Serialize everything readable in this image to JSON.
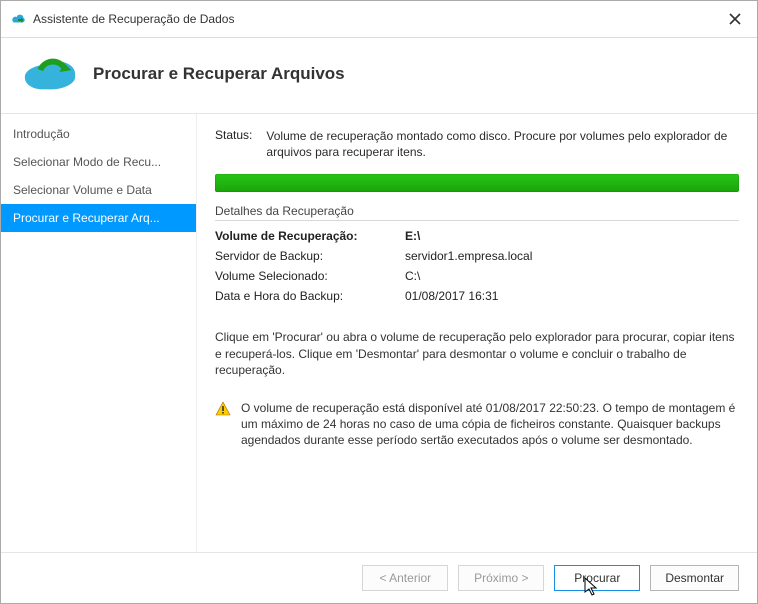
{
  "window": {
    "title": "Assistente de Recuperação de Dados"
  },
  "header": {
    "page_title": "Procurar e Recuperar Arquivos"
  },
  "sidebar": {
    "items": [
      {
        "label": "Introdução"
      },
      {
        "label": "Selecionar Modo de Recu..."
      },
      {
        "label": "Selecionar Volume e Data"
      },
      {
        "label": "Procurar e Recuperar Arq..."
      }
    ],
    "active_index": 3
  },
  "status": {
    "label": "Status:",
    "text": "Volume de recuperação montado como disco. Procure por volumes pelo explorador de arquivos para recuperar itens."
  },
  "recovery": {
    "section_title": "Detalhes da Recuperação",
    "rows": [
      {
        "label": "Volume de Recuperação:",
        "value": "E:\\",
        "bold": true
      },
      {
        "label": "Servidor de Backup:",
        "value": "servidor1.empresa.local"
      },
      {
        "label": "Volume Selecionado:",
        "value": "C:\\"
      },
      {
        "label": "Data e Hora do Backup:",
        "value": "01/08/2017 16:31"
      }
    ]
  },
  "instructions": "Clique em 'Procurar' ou abra o volume de recuperação pelo explorador para procurar, copiar itens e recuperá-los. Clique em 'Desmontar' para desmontar o volume e concluir o trabalho de recuperação.",
  "warning": "O volume de recuperação está disponível até 01/08/2017 22:50:23. O tempo de montagem é um máximo de 24 horas no caso de uma cópia de ficheiros constante. Quaisquer backups agendados durante esse período sertão executados após o volume ser desmontado.",
  "footer": {
    "back": "< Anterior",
    "next": "Próximo >",
    "browse": "Procurar",
    "unmount": "Desmontar"
  }
}
